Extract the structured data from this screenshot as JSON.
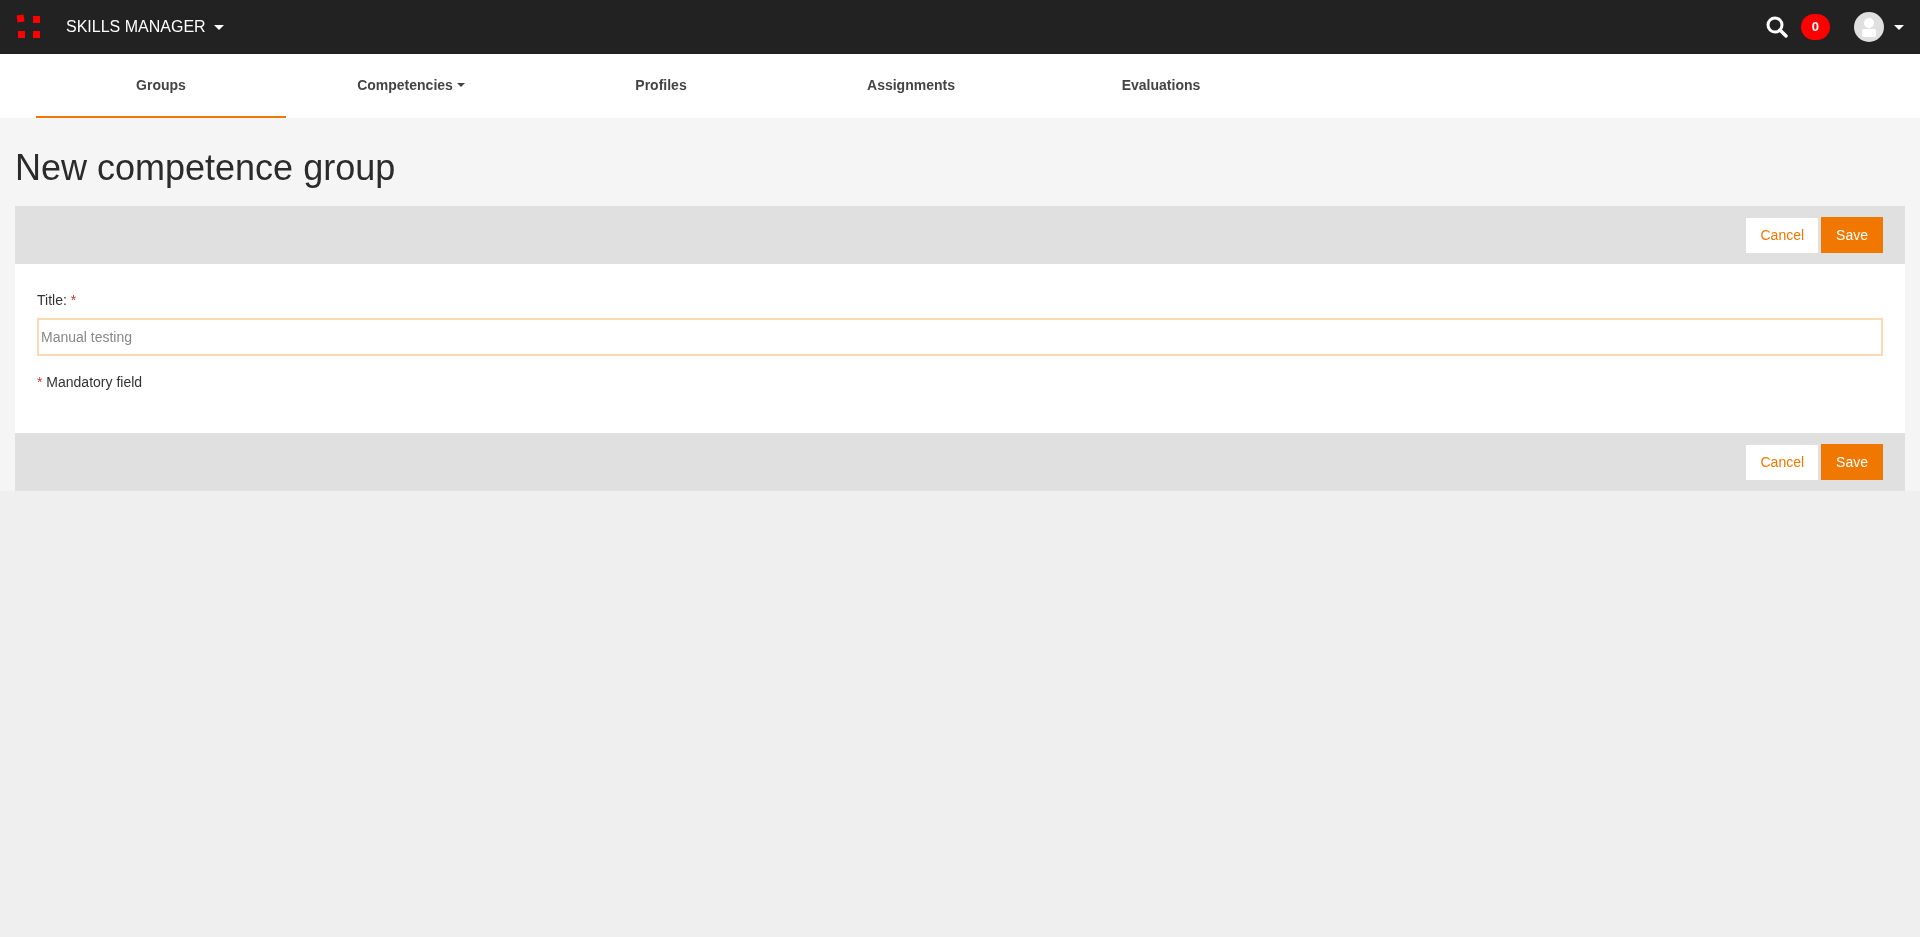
{
  "app": {
    "title": "SKILLS MANAGER",
    "notification_count": "0"
  },
  "tabs": [
    {
      "label": "Groups",
      "selected": true,
      "dropdown": false
    },
    {
      "label": "Competencies",
      "selected": false,
      "dropdown": true
    },
    {
      "label": "Profiles",
      "selected": false,
      "dropdown": false
    },
    {
      "label": "Assignments",
      "selected": false,
      "dropdown": false
    },
    {
      "label": "Evaluations",
      "selected": false,
      "dropdown": false
    }
  ],
  "page_title": "New competence group",
  "top_actions": [
    "Cancel",
    "Save"
  ],
  "form": {
    "label": "Title:",
    "required_mark": "*",
    "placeholder": "Manual testing",
    "note_mark": "*",
    "note": "Mandatory field"
  },
  "bottom_actions": [
    "Cancel",
    "Save"
  ]
}
